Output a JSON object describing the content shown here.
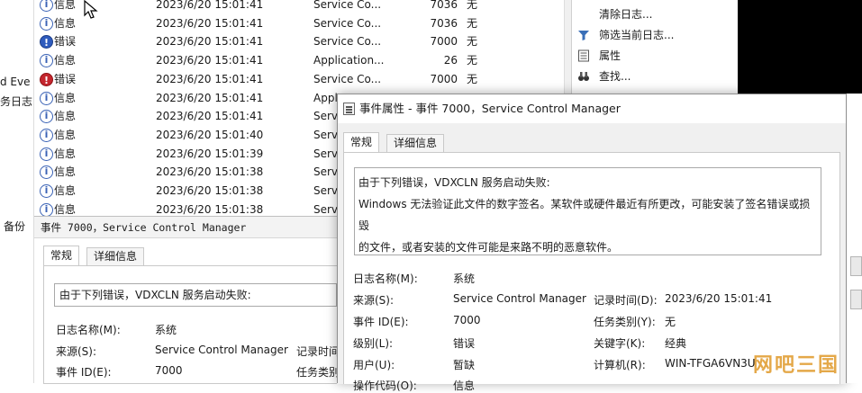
{
  "left_strip": {
    "items": [
      "d Eve",
      "务日志",
      "备份"
    ]
  },
  "event_list": {
    "rows": [
      {
        "level": "信息",
        "kind": "info",
        "datetime": "2023/6/20 15:01:41",
        "source": "Service Co...",
        "event_id": "7036",
        "category": "无"
      },
      {
        "level": "信息",
        "kind": "info",
        "datetime": "2023/6/20 15:01:41",
        "source": "Service Co...",
        "event_id": "7036",
        "category": "无"
      },
      {
        "level": "错误",
        "kind": "err-blue",
        "datetime": "2023/6/20 15:01:41",
        "source": "Service Co...",
        "event_id": "7000",
        "category": "无"
      },
      {
        "level": "信息",
        "kind": "info",
        "datetime": "2023/6/20 15:01:41",
        "source": "Application...",
        "event_id": "26",
        "category": "无"
      },
      {
        "level": "错误",
        "kind": "err",
        "datetime": "2023/6/20 15:01:41",
        "source": "Service Co...",
        "event_id": "7000",
        "category": "无"
      },
      {
        "level": "信息",
        "kind": "info",
        "datetime": "2023/6/20 15:01:41",
        "source": "Appl",
        "event_id": "",
        "category": ""
      },
      {
        "level": "信息",
        "kind": "info",
        "datetime": "2023/6/20 15:01:41",
        "source": "Serv",
        "event_id": "",
        "category": ""
      },
      {
        "level": "信息",
        "kind": "info",
        "datetime": "2023/6/20 15:01:40",
        "source": "Serv",
        "event_id": "",
        "category": ""
      },
      {
        "level": "信息",
        "kind": "info",
        "datetime": "2023/6/20 15:01:39",
        "source": "Serv",
        "event_id": "",
        "category": ""
      },
      {
        "level": "信息",
        "kind": "info",
        "datetime": "2023/6/20 15:01:38",
        "source": "Serv",
        "event_id": "",
        "category": ""
      },
      {
        "level": "信息",
        "kind": "info",
        "datetime": "2023/6/20 15:01:38",
        "source": "Serv",
        "event_id": "",
        "category": ""
      },
      {
        "level": "信息",
        "kind": "info",
        "datetime": "2023/6/20 15:01:38",
        "source": "Serv",
        "event_id": "",
        "category": ""
      }
    ]
  },
  "actions": {
    "items": [
      {
        "label": "清除日志...",
        "icon": "blank-icon"
      },
      {
        "label": "筛选当前日志...",
        "icon": "filter-icon"
      },
      {
        "label": "属性",
        "icon": "properties-icon"
      },
      {
        "label": "查找...",
        "icon": "binoculars-icon"
      }
    ]
  },
  "preview": {
    "header": "事件 7000，Service Control Manager",
    "tabs": [
      "常规",
      "详细信息"
    ],
    "message": "由于下列错误，VDXCLN 服务启动失败:",
    "fields": {
      "log_name_label": "日志名称(M):",
      "log_name_value": "系统",
      "source_label": "来源(S):",
      "source_value": "Service Control Manager",
      "recorded_label": "记录时间",
      "event_id_label": "事件 ID(E):",
      "event_id_value": "7000",
      "task_label": "任务类别"
    }
  },
  "dialog": {
    "title": "事件属性 - 事件 7000，Service Control Manager",
    "tabs": [
      "常规",
      "详细信息"
    ],
    "message_line1": "由于下列错误，VDXCLN 服务启动失败:",
    "message_line2": "Windows 无法验证此文件的数字签名。某软件或硬件最近有所更改，可能安装了签名错误或损毁",
    "message_line3": "的文件，或者安装的文件可能是来路不明的恶意软件。",
    "fields": {
      "log_name_label": "日志名称(M):",
      "log_name_value": "系统",
      "source_label": "来源(S):",
      "source_value": "Service Control Manager",
      "recorded_label": "记录时间(D):",
      "recorded_value": "2023/6/20 15:01:41",
      "event_id_label": "事件 ID(E):",
      "event_id_value": "7000",
      "task_label": "任务类别(Y):",
      "task_value": "无",
      "level_label": "级别(L):",
      "level_value": "错误",
      "keywords_label": "关键字(K):",
      "keywords_value": "经典",
      "user_label": "用户(U):",
      "user_value": "暂缺",
      "computer_label": "计算机(R):",
      "computer_value": "WIN-TFGA6VN3U",
      "opcode_label": "操作代码(O):",
      "opcode_value": "信息"
    }
  },
  "watermark": "网吧三国",
  "colors": {
    "info": "#3a62b5",
    "error_red": "#c4262e",
    "error_blue": "#2e5bbd",
    "watermark": "#e09a2a"
  }
}
